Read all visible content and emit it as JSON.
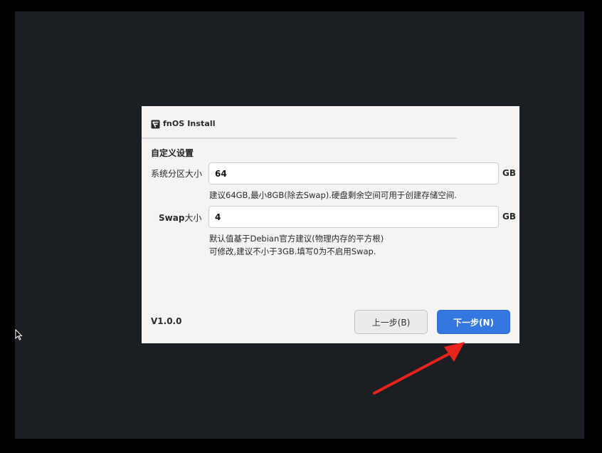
{
  "window": {
    "title": "fnOS Install",
    "icon": "fnos-logo-icon"
  },
  "section": {
    "title": "自定义设置"
  },
  "system_partition": {
    "label": "系统分区大小",
    "value": "64",
    "unit": "GB",
    "hint": "建议64GB,最小8GB(除去Swap).硬盘剩余空间可用于创建存储空间."
  },
  "swap": {
    "label_prefix": "Swap",
    "label_suffix": "大小",
    "value": "4",
    "unit": "GB",
    "hint_line1": "默认值基于Debian官方建议(物理内存的平方根)",
    "hint_line2": "可修改,建议不小于3GB.填写0为不启用Swap."
  },
  "footer": {
    "version": "V1.0.0",
    "prev_label": "上一步(B)",
    "next_label": "下一步(N)"
  },
  "colors": {
    "background": "#1b1e23",
    "dialog": "#f5f4f2",
    "primary_button": "#3477e0",
    "annotation_arrow": "#e8231c"
  }
}
